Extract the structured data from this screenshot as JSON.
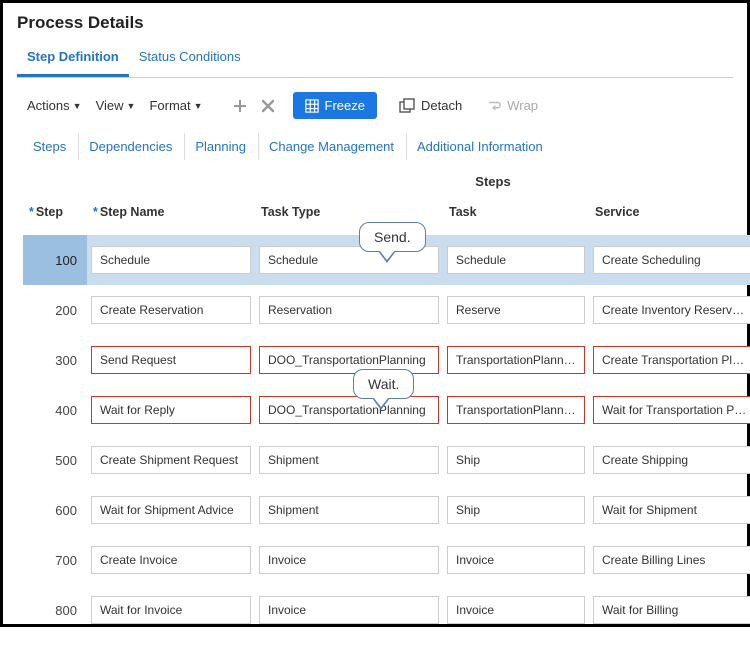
{
  "page_title": "Process Details",
  "main_tabs": {
    "definition": "Step Definition",
    "status": "Status Conditions"
  },
  "toolbar": {
    "actions": "Actions",
    "view": "View",
    "format": "Format",
    "freeze": "Freeze",
    "detach": "Detach",
    "wrap": "Wrap"
  },
  "sub_tabs": {
    "steps": "Steps",
    "dependencies": "Dependencies",
    "planning": "Planning",
    "change_mgmt": "Change Management",
    "additional": "Additional Information"
  },
  "columns": {
    "steps_header_group": "Steps",
    "step": "Step",
    "step_name": "Step Name",
    "task_type": "Task Type",
    "task": "Task",
    "service": "Service"
  },
  "callouts": {
    "send": "Send.",
    "wait": "Wait."
  },
  "rows": [
    {
      "step": "100",
      "name": "Schedule",
      "task_type": "Schedule",
      "task": "Schedule",
      "service": "Create Scheduling"
    },
    {
      "step": "200",
      "name": "Create Reservation",
      "task_type": "Reservation",
      "task": "Reserve",
      "service": "Create Inventory Reservation"
    },
    {
      "step": "300",
      "name": "Send Request",
      "task_type": "DOO_TransportationPlanning",
      "task": "TransportationPlanning",
      "service": "Create Transportation Planning"
    },
    {
      "step": "400",
      "name": "Wait for Reply",
      "task_type": "DOO_TransportationPlanning",
      "task": "TransportationPlanning",
      "service": "Wait for Transportation Planning"
    },
    {
      "step": "500",
      "name": "Create Shipment Request",
      "task_type": "Shipment",
      "task": "Ship",
      "service": "Create Shipping"
    },
    {
      "step": "600",
      "name": "Wait for Shipment Advice",
      "task_type": "Shipment",
      "task": "Ship",
      "service": "Wait for Shipment"
    },
    {
      "step": "700",
      "name": "Create Invoice",
      "task_type": "Invoice",
      "task": "Invoice",
      "service": "Create Billing Lines"
    },
    {
      "step": "800",
      "name": "Wait for Invoice",
      "task_type": "Invoice",
      "task": "Invoice",
      "service": "Wait for Billing"
    }
  ]
}
